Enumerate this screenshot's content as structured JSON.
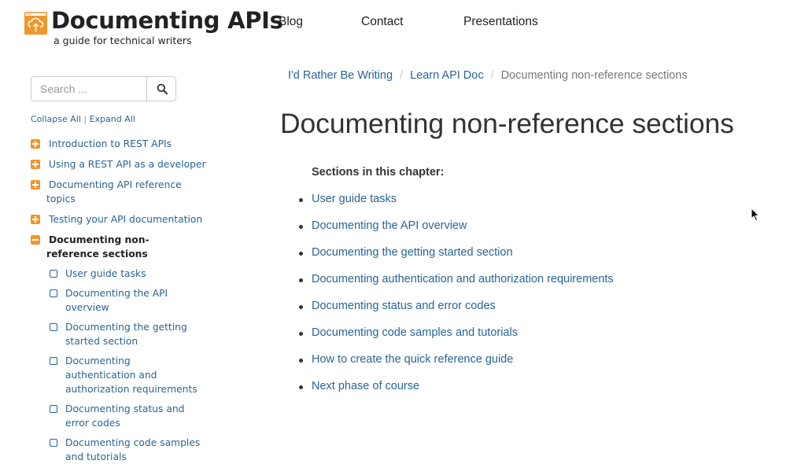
{
  "header": {
    "title": "Documenting APIs",
    "subtitle": "a guide for technical writers",
    "logo_icon": "cloud-upload-icon",
    "brand_color": "#f0962c",
    "nav": [
      {
        "label": "Blog"
      },
      {
        "label": "Contact"
      },
      {
        "label": "Presentations"
      }
    ]
  },
  "sidebar": {
    "search_placeholder": "Search ...",
    "collapse_all": "Collapse All",
    "separator": "|",
    "expand_all": "Expand All",
    "items": [
      {
        "label": "Introduction to REST APIs",
        "state": "collapsed"
      },
      {
        "label": "Using a REST API as a developer",
        "state": "collapsed"
      },
      {
        "label": "Documenting API reference topics",
        "state": "collapsed"
      },
      {
        "label": "Testing your API documentation",
        "state": "collapsed"
      },
      {
        "label": "Documenting non-reference sections",
        "state": "expanded"
      }
    ],
    "subitems": [
      {
        "label": "User guide tasks"
      },
      {
        "label": "Documenting the API overview"
      },
      {
        "label": "Documenting the getting started section"
      },
      {
        "label": "Documenting authentication and authorization requirements"
      },
      {
        "label": "Documenting status and error codes"
      },
      {
        "label": "Documenting code samples and tutorials"
      }
    ],
    "link_color": "#2a6496"
  },
  "breadcrumb": {
    "items": [
      "I'd Rather Be Writing",
      "Learn API Doc"
    ],
    "separator": "/",
    "current": "Documenting non-reference sections"
  },
  "main": {
    "title": "Documenting non-reference sections",
    "sections_heading": "Sections in this chapter:",
    "sections": [
      "User guide tasks",
      "Documenting the API overview",
      "Documenting the getting started section",
      "Documenting authentication and authorization requirements",
      "Documenting status and error codes",
      "Documenting code samples and tutorials",
      "How to create the quick reference guide",
      "Next phase of course"
    ]
  }
}
